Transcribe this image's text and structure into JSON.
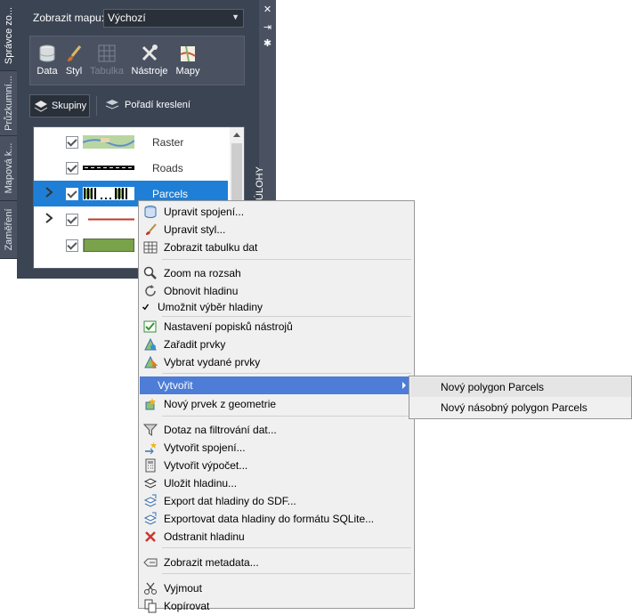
{
  "palette": {
    "vertical_tabs": [
      "Správce zo...",
      "Průzkumní...",
      "Mapová k...",
      "Zaměření"
    ],
    "side_label": "ÚLOHY",
    "map_select": {
      "label": "Zobrazit mapu:",
      "value": "Výchozí"
    },
    "ribbon": [
      {
        "label": "Data",
        "icon": "database-icon",
        "enabled": true
      },
      {
        "label": "Styl",
        "icon": "brush-icon",
        "enabled": true
      },
      {
        "label": "Tabulka",
        "icon": "table-icon",
        "enabled": false
      },
      {
        "label": "Nástroje",
        "icon": "tools-icon",
        "enabled": true
      },
      {
        "label": "Mapy",
        "icon": "map-icon",
        "enabled": true
      }
    ],
    "groups_button": "Skupiny",
    "draw_order_button": "Pořadí kreslení",
    "layers": [
      {
        "name": "Raster",
        "checked": true,
        "selected": false
      },
      {
        "name": "Roads",
        "checked": true,
        "selected": false
      },
      {
        "name": "Parcels",
        "checked": true,
        "selected": true
      },
      {
        "name": "",
        "checked": true,
        "selected": false
      },
      {
        "name": "",
        "checked": true,
        "selected": false
      }
    ]
  },
  "context_menu": {
    "items": [
      {
        "label": "Upravit spojení...",
        "icon": "db-edit-icon"
      },
      {
        "label": "Upravit styl...",
        "icon": "brush-icon"
      },
      {
        "label": "Zobrazit tabulku dat",
        "icon": "table-icon"
      },
      {
        "label": "Zoom na rozsah",
        "icon": "zoom-icon"
      },
      {
        "label": "Obnovit hladinu",
        "icon": "refresh-icon"
      },
      {
        "label": "Umožnit výběr hladiny",
        "icon": "checkmark-icon"
      },
      {
        "label": "Nastavení popisků nástrojů",
        "icon": "tooltip-check-icon"
      },
      {
        "label": "Zařadit prvky",
        "icon": "checkin-icon"
      },
      {
        "label": "Vybrat vydané prvky",
        "icon": "select-checked-out-icon"
      },
      {
        "label": "Vytvořit",
        "icon": "",
        "submenu": true
      },
      {
        "label": "Nový prvek z geometrie",
        "icon": "new-feature-icon"
      },
      {
        "label": "Dotaz na filtrování dat...",
        "icon": "filter-icon"
      },
      {
        "label": "Vytvořit spojení...",
        "icon": "join-icon"
      },
      {
        "label": "Vytvořit výpočet...",
        "icon": "calculator-icon"
      },
      {
        "label": "Uložit hladinu...",
        "icon": "save-layer-icon"
      },
      {
        "label": "Export dat hladiny do SDF...",
        "icon": "export-sdf-icon"
      },
      {
        "label": "Exportovat data hladiny do formátu SQLite...",
        "icon": "export-sqlite-icon"
      },
      {
        "label": "Odstranit hladinu",
        "icon": "delete-icon"
      },
      {
        "label": "Zobrazit metadata...",
        "icon": "metadata-icon"
      },
      {
        "label": "Vyjmout",
        "icon": "cut-icon"
      },
      {
        "label": "Kopírovat",
        "icon": "copy-icon"
      }
    ],
    "submenu": [
      {
        "label": "Nový polygon Parcels"
      },
      {
        "label": "Nový násobný polygon Parcels"
      }
    ]
  },
  "colors": {
    "panel": "#3b4453",
    "selection": "#1f7fd6",
    "menu_highlight": "#4d7dd6"
  }
}
